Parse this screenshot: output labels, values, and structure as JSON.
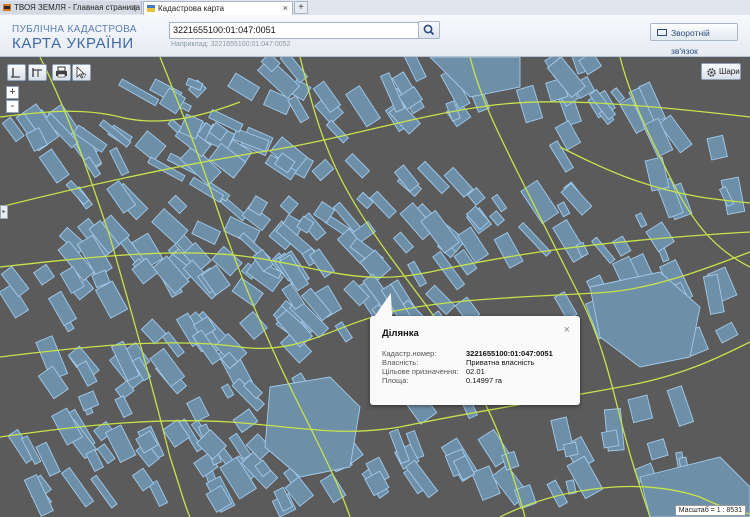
{
  "browser": {
    "tabs": [
      {
        "label": "ТВОЯ ЗЕМЛЯ - Главная страница",
        "active": false
      },
      {
        "label": "Кадастрова карта",
        "active": true
      }
    ],
    "new_tab": "+"
  },
  "header": {
    "logo_line1": "ПУБЛІЧНА КАДАСТРОВА",
    "logo_line2": "КАРТА УКРАЇНИ",
    "search_value": "3221655100:01:047:0051",
    "search_hint": "Наприклад: 3221655100:01:047:0052",
    "feedback_label": "Зворотній зв'язок"
  },
  "map": {
    "layers_label": "Шари",
    "zoom_in": "+",
    "zoom_out": "-",
    "scale_text": "Масштаб = 1 : 8531",
    "colors": {
      "background": "#5b5b5b",
      "parcel_fill": "#6e8fa8",
      "parcel_stroke": "#9ec6e8",
      "boundary": "#c7e64a"
    }
  },
  "popup": {
    "title": "Ділянка",
    "close": "×",
    "fields": [
      {
        "label": "Кадастр.номер:",
        "value": "3221655100:01:047:0051"
      },
      {
        "label": "Власність:",
        "value": "Приватна власність"
      },
      {
        "label": "Цільове призначення:",
        "value": "02.01"
      },
      {
        "label": "Площа:",
        "value": "0.14997 га"
      }
    ]
  }
}
